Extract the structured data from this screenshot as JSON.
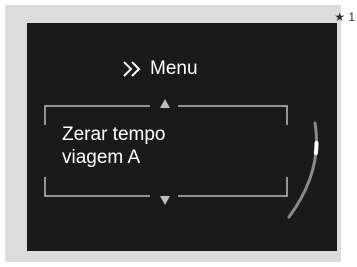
{
  "footnote": "★ 1",
  "menu": {
    "title": "Menu"
  },
  "item": {
    "label": "Zerar tempo\nviagem A"
  },
  "scroll": {
    "position": 0.25
  },
  "colors": {
    "screen": "#1a1a1a",
    "frame": "#dcdcdc",
    "text": "#ffffff",
    "lines": "#bdbdbd",
    "track": "#8a8a8a"
  },
  "icons": {
    "menu": "double-chevron-right-icon",
    "up": "triangle-up-icon",
    "down": "triangle-down-icon"
  }
}
